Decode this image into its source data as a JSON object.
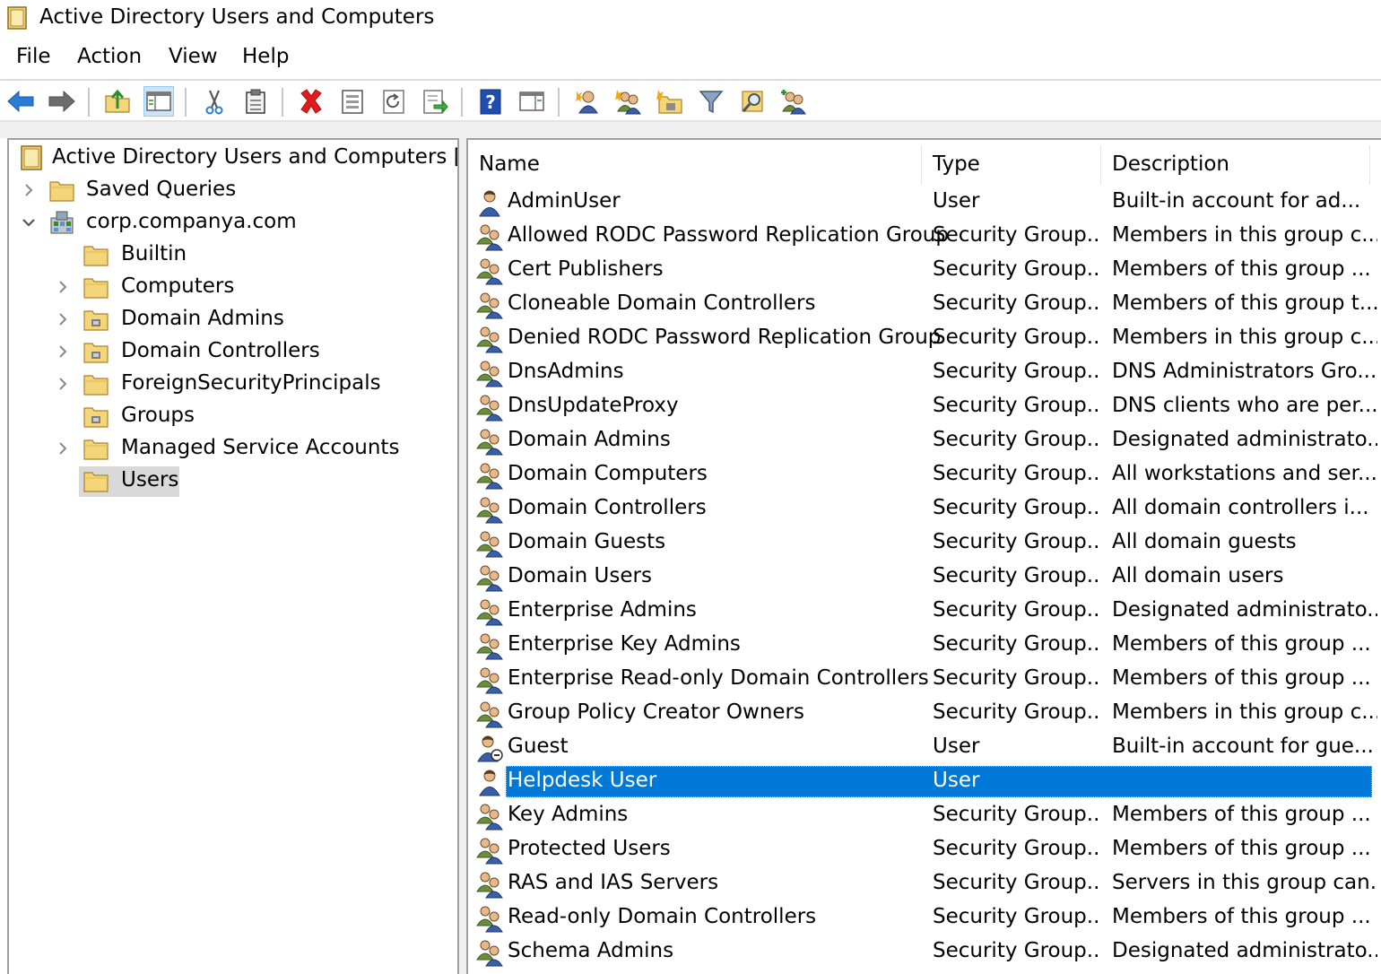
{
  "window": {
    "title": "Active Directory Users and Computers"
  },
  "menu": [
    "File",
    "Action",
    "View",
    "Help"
  ],
  "toolbar": {
    "buttons": [
      "back-arrow-icon",
      "forward-arrow-icon",
      "up-folder-icon",
      "show-console-tree-icon",
      "cut-icon",
      "paste-icon",
      "delete-icon",
      "properties-icon",
      "refresh-icon",
      "export-list-icon",
      "help-icon",
      "action-pane-icon",
      "new-user-icon",
      "new-group-icon",
      "new-ou-icon",
      "filter-icon",
      "find-icon",
      "add-to-group-icon"
    ]
  },
  "tree": {
    "root": "Active Directory Users and Computers [CAI",
    "items": [
      {
        "label": "Saved Queries",
        "level": 1,
        "expander": "collapsed"
      },
      {
        "label": "corp.companya.com",
        "level": 1,
        "expander": "expanded"
      },
      {
        "label": "Builtin",
        "level": 2,
        "expander": "none"
      },
      {
        "label": "Computers",
        "level": 2,
        "expander": "collapsed"
      },
      {
        "label": "Domain Admins",
        "level": 2,
        "expander": "collapsed"
      },
      {
        "label": "Domain Controllers",
        "level": 2,
        "expander": "collapsed"
      },
      {
        "label": "ForeignSecurityPrincipals",
        "level": 2,
        "expander": "collapsed"
      },
      {
        "label": "Groups",
        "level": 2,
        "expander": "none"
      },
      {
        "label": "Managed Service Accounts",
        "level": 2,
        "expander": "collapsed"
      },
      {
        "label": "Users",
        "level": 2,
        "expander": "none",
        "selected": true
      }
    ]
  },
  "list": {
    "columns": [
      "Name",
      "Type",
      "Description"
    ],
    "rows": [
      {
        "name": "AdminUser",
        "type": "User",
        "description": "Built-in account for ad...",
        "icon": "user-icon"
      },
      {
        "name": "Allowed RODC Password Replication Group",
        "type": "Security Group...",
        "description": "Members in this group c...",
        "icon": "group-icon"
      },
      {
        "name": "Cert Publishers",
        "type": "Security Group...",
        "description": "Members of this group ...",
        "icon": "group-icon"
      },
      {
        "name": "Cloneable Domain Controllers",
        "type": "Security Group...",
        "description": "Members of this group t...",
        "icon": "group-icon"
      },
      {
        "name": "Denied RODC Password Replication Group",
        "type": "Security Group...",
        "description": "Members in this group c...",
        "icon": "group-icon"
      },
      {
        "name": "DnsAdmins",
        "type": "Security Group...",
        "description": "DNS Administrators Gro...",
        "icon": "group-icon"
      },
      {
        "name": "DnsUpdateProxy",
        "type": "Security Group...",
        "description": "DNS clients who are per...",
        "icon": "group-icon"
      },
      {
        "name": "Domain Admins",
        "type": "Security Group...",
        "description": "Designated administrato...",
        "icon": "group-icon"
      },
      {
        "name": "Domain Computers",
        "type": "Security Group...",
        "description": "All workstations and ser...",
        "icon": "group-icon"
      },
      {
        "name": "Domain Controllers",
        "type": "Security Group...",
        "description": "All domain controllers i...",
        "icon": "group-icon"
      },
      {
        "name": "Domain Guests",
        "type": "Security Group...",
        "description": "All domain guests",
        "icon": "group-icon"
      },
      {
        "name": "Domain Users",
        "type": "Security Group...",
        "description": "All domain users",
        "icon": "group-icon"
      },
      {
        "name": "Enterprise Admins",
        "type": "Security Group...",
        "description": "Designated administrato...",
        "icon": "group-icon"
      },
      {
        "name": "Enterprise Key Admins",
        "type": "Security Group...",
        "description": "Members of this group ...",
        "icon": "group-icon"
      },
      {
        "name": "Enterprise Read-only Domain Controllers",
        "type": "Security Group...",
        "description": "Members of this group ...",
        "icon": "group-icon"
      },
      {
        "name": "Group Policy Creator Owners",
        "type": "Security Group...",
        "description": "Members in this group c...",
        "icon": "group-icon"
      },
      {
        "name": "Guest",
        "type": "User",
        "description": "Built-in account for gue...",
        "icon": "disabled-user-icon"
      },
      {
        "name": "Helpdesk User",
        "type": "User",
        "description": "",
        "icon": "user-icon",
        "selected": true
      },
      {
        "name": "Key Admins",
        "type": "Security Group...",
        "description": "Members of this group ...",
        "icon": "group-icon"
      },
      {
        "name": "Protected Users",
        "type": "Security Group...",
        "description": "Members of this group ...",
        "icon": "group-icon"
      },
      {
        "name": "RAS and IAS Servers",
        "type": "Security Group...",
        "description": "Servers in this group can...",
        "icon": "group-icon"
      },
      {
        "name": "Read-only Domain Controllers",
        "type": "Security Group...",
        "description": "Members of this group ...",
        "icon": "group-icon"
      },
      {
        "name": "Schema Admins",
        "type": "Security Group...",
        "description": "Designated administrato...",
        "icon": "group-icon"
      }
    ]
  },
  "colors": {
    "selection": "#0078d7",
    "tree_selection": "#d9d9d9",
    "folder": "#f5d57a",
    "separator": "#a0a0a0"
  }
}
